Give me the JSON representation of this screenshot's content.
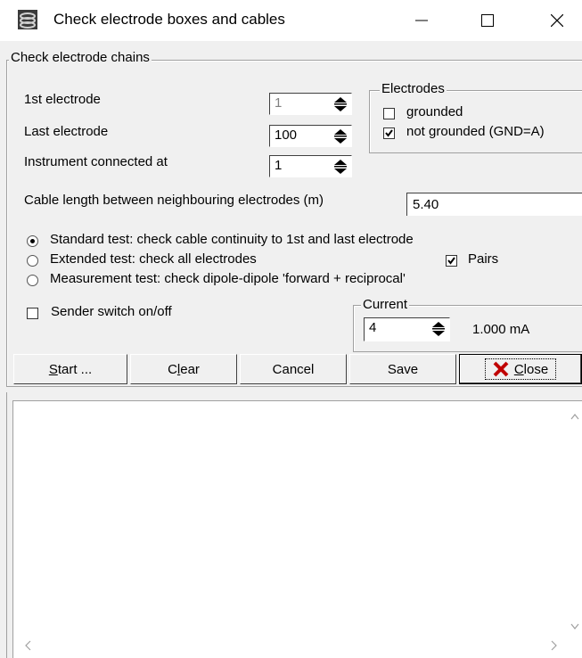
{
  "window": {
    "title": "Check electrode boxes and cables"
  },
  "icons": {
    "app": "electrode-app-icon",
    "minimize": "minimize-icon",
    "maximize": "maximize-icon",
    "close": "close-icon",
    "close_button": "red-x-icon"
  },
  "chains": {
    "legend": "Check electrode chains",
    "first_electrode": {
      "label": "1st electrode",
      "value": "1"
    },
    "last_electrode": {
      "label": "Last electrode",
      "value": "100"
    },
    "instrument": {
      "label": "Instrument connected at",
      "value": "1"
    },
    "cable_length": {
      "label": "Cable length between neighbouring electrodes (m)",
      "value": "5.40"
    }
  },
  "electrodes_group": {
    "legend": "Electrodes",
    "grounded": {
      "label": "grounded",
      "checked": false
    },
    "not_grounded": {
      "label": "not grounded (GND=A)",
      "checked": true
    }
  },
  "tests": {
    "standard": {
      "label": "Standard test: check cable continuity to 1st and last electrode",
      "selected": true
    },
    "extended": {
      "label": "Extended test: check all electrodes",
      "selected": false
    },
    "measurement": {
      "label": "Measurement test: check dipole-dipole 'forward + reciprocal'",
      "selected": false
    },
    "pairs": {
      "label": "Pairs",
      "checked": true
    }
  },
  "sender": {
    "label": "Sender switch on/off",
    "checked": false
  },
  "current": {
    "legend": "Current",
    "value": "4",
    "display": "1.000 mA"
  },
  "buttons": {
    "start_mn": "S",
    "start_rest": "tart ...",
    "clear_pre": "C",
    "clear_mn": "l",
    "clear_rest": "ear",
    "cancel": "Cancel",
    "save": "Save",
    "close_mn": "C",
    "close_rest": "lose"
  },
  "log": {
    "content": ""
  },
  "colors": {
    "close_x": "#c00000",
    "titlebar": "#ffffff",
    "dialog": "#f0f0f0"
  }
}
